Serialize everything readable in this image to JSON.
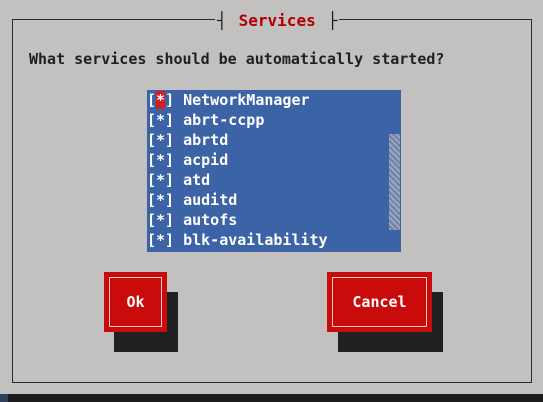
{
  "dialog": {
    "title": "Services",
    "prompt": "What services should be automatically started?"
  },
  "services": [
    {
      "checkbox": "[*]",
      "name": "NetworkManager",
      "selected": true
    },
    {
      "checkbox": "[*]",
      "name": "abrt-ccpp",
      "selected": true
    },
    {
      "checkbox": "[*]",
      "name": "abrtd",
      "selected": true
    },
    {
      "checkbox": "[*]",
      "name": "acpid",
      "selected": true
    },
    {
      "checkbox": "[*]",
      "name": "atd",
      "selected": true
    },
    {
      "checkbox": "[*]",
      "name": "auditd",
      "selected": true
    },
    {
      "checkbox": "[*]",
      "name": "autofs",
      "selected": true
    },
    {
      "checkbox": "[*]",
      "name": "blk-availability",
      "selected": true
    }
  ],
  "buttons": {
    "ok_label": "Ok",
    "cancel_label": "Cancel"
  },
  "colors": {
    "dialog_bg": "#c3c1bf",
    "list_bg": "#3b63a6",
    "button_red": "#c90b0b",
    "title_red": "#b00000",
    "screen_bg": "#2f3f5c"
  }
}
